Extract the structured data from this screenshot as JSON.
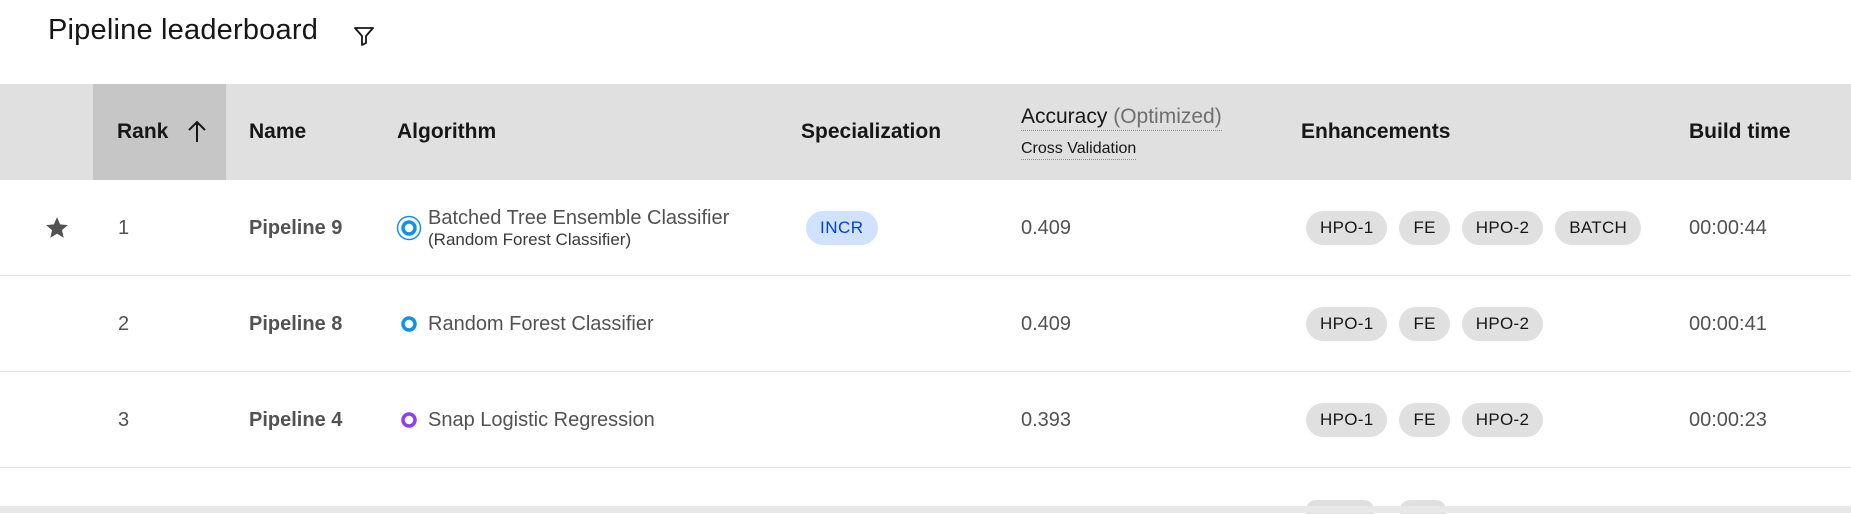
{
  "header": {
    "title": "Pipeline leaderboard",
    "filter_icon": "filter-icon"
  },
  "columns": {
    "rank": "Rank",
    "name": "Name",
    "algorithm": "Algorithm",
    "specialization": "Specialization",
    "accuracy": "Accuracy",
    "accuracy_note": "(Optimized)",
    "accuracy_sub": "Cross Validation",
    "enhancements": "Enhancements",
    "build_time": "Build time"
  },
  "rows": [
    {
      "rank": "1",
      "name": "Pipeline 9",
      "algorithm": "Batched Tree Ensemble Classifier",
      "algorithm_sub": "(Random Forest Classifier)",
      "specialization": "INCR",
      "accuracy": "0.409",
      "enhancements": [
        "HPO-1",
        "FE",
        "HPO-2",
        "BATCH"
      ],
      "build_time": "00:00:44",
      "starred": true
    },
    {
      "rank": "2",
      "name": "Pipeline 8",
      "algorithm": "Random Forest Classifier",
      "accuracy": "0.409",
      "enhancements": [
        "HPO-1",
        "FE",
        "HPO-2"
      ],
      "build_time": "00:00:41"
    },
    {
      "rank": "3",
      "name": "Pipeline 4",
      "algorithm": "Snap Logistic Regression",
      "accuracy": "0.393",
      "enhancements": [
        "HPO-1",
        "FE",
        "HPO-2"
      ],
      "build_time": "00:00:23"
    }
  ],
  "colors": {
    "header_bg": "#e0e0e0",
    "sorted_col_bg": "#c6c6c6",
    "tree_icon": "#1192e8",
    "logreg_icon": "#8a3ffc",
    "incr_bg": "#d0e2ff",
    "incr_text": "#0043ce"
  }
}
